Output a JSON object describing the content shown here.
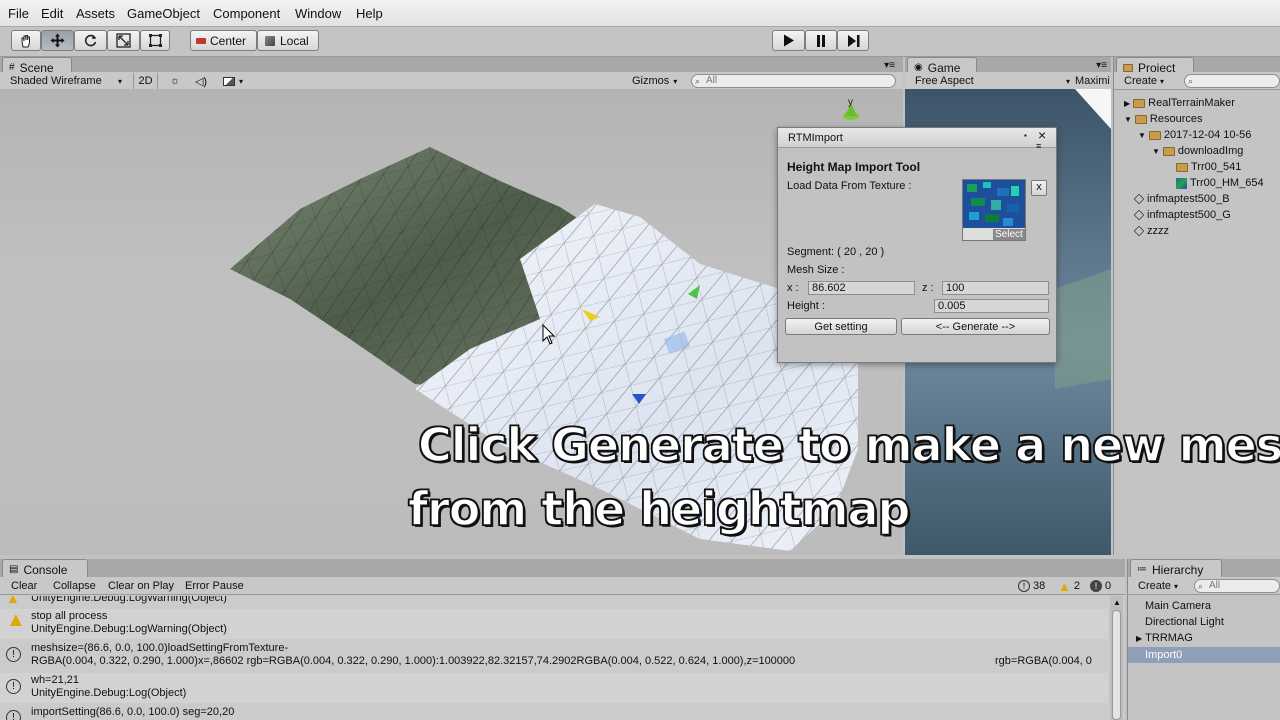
{
  "menu": [
    "File",
    "Edit",
    "Assets",
    "GameObject",
    "Component",
    "Window",
    "Help"
  ],
  "toolbar": {
    "pivot_mode": "Center",
    "pivot_rotation": "Local"
  },
  "scene": {
    "tab": "Scene",
    "shading_mode": "Shaded Wireframe",
    "mode_2d": "2D",
    "gizmos": "Gizmos",
    "search_placeholder": "All",
    "axis_label": "y"
  },
  "game": {
    "tab": "Game",
    "aspect": "Free Aspect",
    "maximize": "Maximi"
  },
  "project": {
    "tab": "Project",
    "create": "Create",
    "items": [
      "RealTerrainMaker",
      "Resources",
      "2017-12-04 10-56",
      "downloadImg",
      "Trr00_541",
      "Trr00_HM_654",
      "infmaptest500_B",
      "infmaptest500_G",
      "zzzz"
    ]
  },
  "dialog": {
    "title": "RTMImport",
    "heading": "Height Map Import Tool",
    "load_label": "Load Data From Texture :",
    "select": "Select",
    "clear": "x",
    "segment": "Segment:  ( 20 , 20 )",
    "mesh_size": "Mesh Size :",
    "x_label": "x :",
    "x_value": "86.602",
    "z_label": "z :",
    "z_value": "100",
    "height_label": "Height :",
    "height_value": "0.005",
    "get_setting": "Get setting",
    "generate": "<-- Generate -->"
  },
  "caption": {
    "line1": "Click Generate to make a new mesh",
    "line2": "from the heightmap"
  },
  "console": {
    "tab": "Console",
    "buttons": [
      "Clear",
      "Collapse",
      "Clear on Play",
      "Error Pause"
    ],
    "counts": {
      "log": "38",
      "warn": "2",
      "error": "0"
    },
    "rows": [
      {
        "l1": "UnityEngine.Debug:LogWarning(Object)"
      },
      {
        "l1": "stop all process",
        "l2": "UnityEngine.Debug:LogWarning(Object)"
      },
      {
        "l1": "meshsize=(86.6, 0.0, 100.0)loadSettingFromTexture-",
        "l2": "RGBA(0.004, 0.322, 0.290, 1.000)x=,86602  rgb=RGBA(0.004, 0.322, 0.290, 1.000):1.003922,82.32157,74.2902RGBA(0.004, 0.522, 0.624, 1.000),z=100000",
        "l2b": "rgb=RGBA(0.004, 0"
      },
      {
        "l1": "wh=21,21",
        "l2": "UnityEngine.Debug:Log(Object)"
      },
      {
        "l1": "importSetting(86.6, 0.0, 100.0)    seg=20,20"
      }
    ]
  },
  "hierarchy": {
    "tab": "Hierarchy",
    "create": "Create",
    "search_placeholder": "All",
    "items": [
      "Main Camera",
      "Directional Light",
      "TRRMAG",
      "Import0"
    ]
  },
  "colors": {
    "selection": "#8f9fb8",
    "terrain_dark": "#5e6e5a",
    "mesh_light": "#e8eef8"
  }
}
